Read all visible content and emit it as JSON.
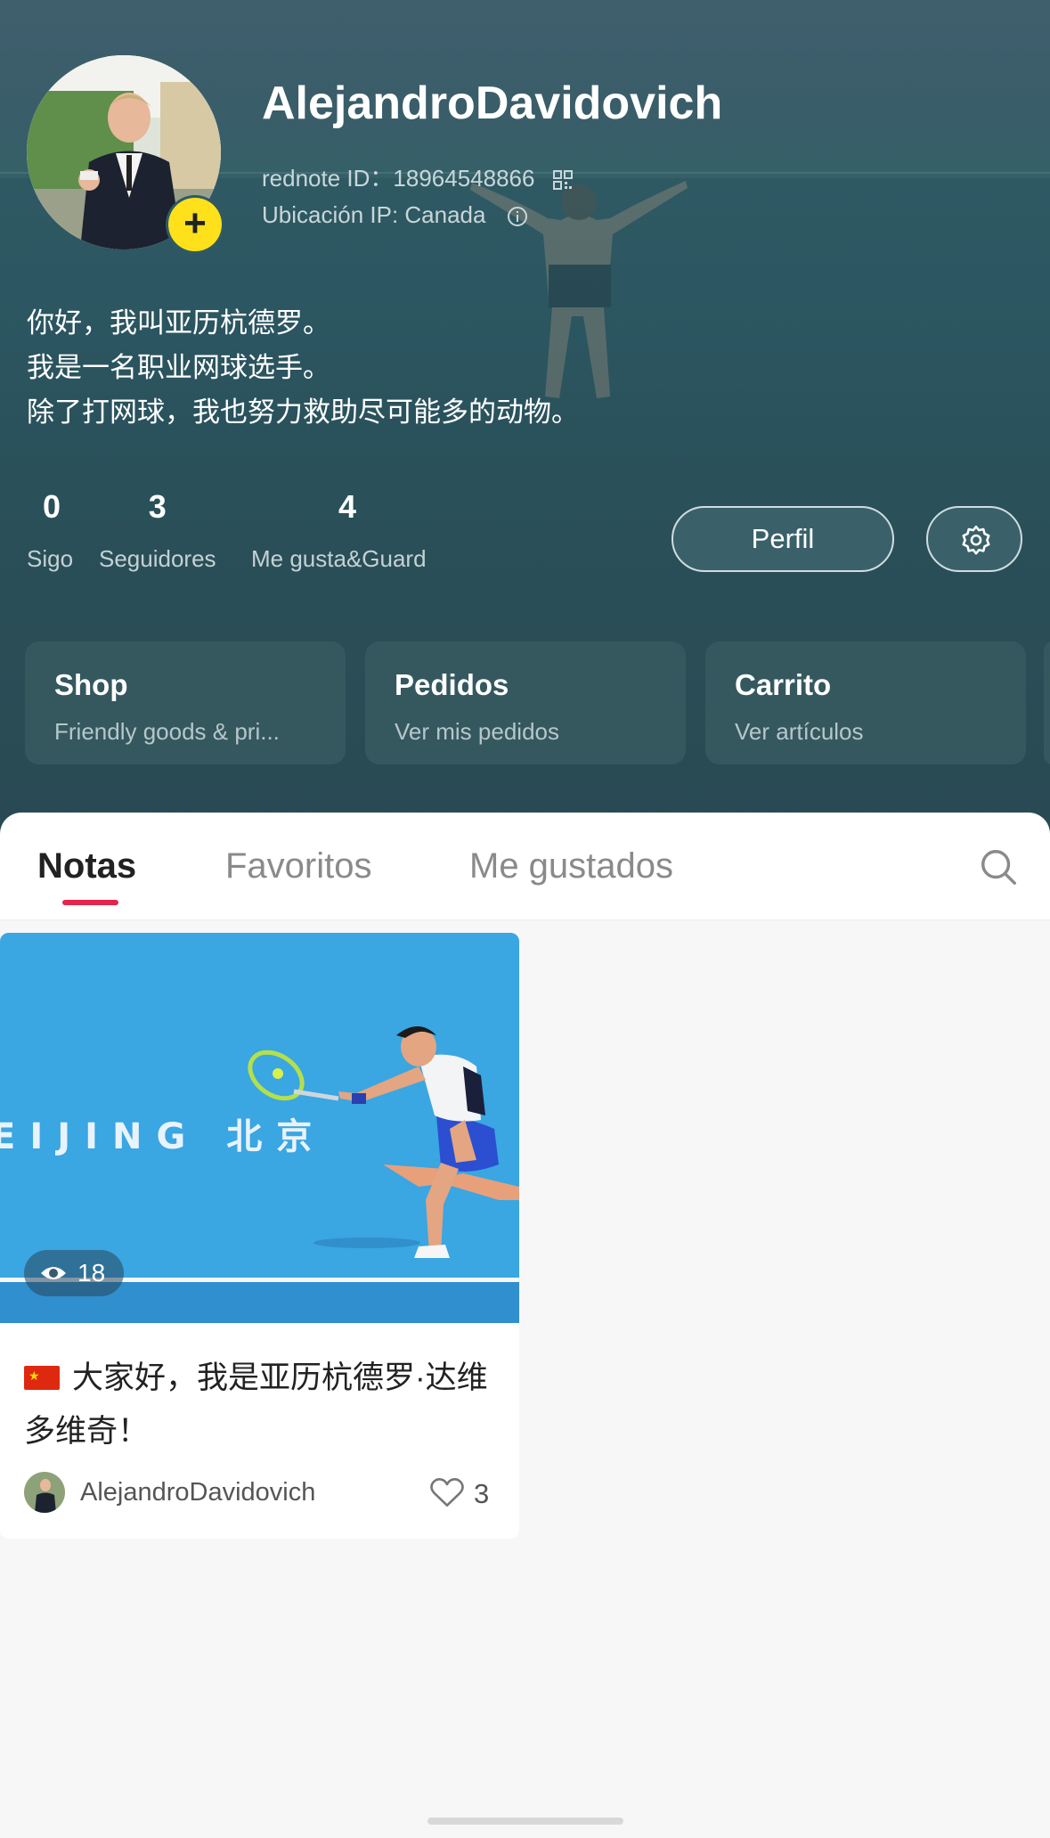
{
  "profile": {
    "username": "AlejandroDavidovich",
    "id_line": "rednote ID：18964548866",
    "ip_line": "Ubicación IP: Canada",
    "bio": [
      "你好，我叫亚历杭德罗。",
      "我是一名职业网球选手。",
      "除了打网球，我也努力救助尽可能多的动物。"
    ],
    "add_badge": "+"
  },
  "stats": [
    {
      "value": "0",
      "label": "Sigo"
    },
    {
      "value": "3",
      "label": "Seguidores"
    },
    {
      "value": "4",
      "label": "Me gusta&Guard"
    }
  ],
  "actions": {
    "perfil_label": "Perfil",
    "settings_icon": "gear-icon"
  },
  "cards": [
    {
      "title": "Shop",
      "subtitle": "Friendly goods & pri..."
    },
    {
      "title": "Pedidos",
      "subtitle": "Ver mis pedidos"
    },
    {
      "title": "Carrito",
      "subtitle": "Ver artículos"
    }
  ],
  "tabs": [
    {
      "label": "Notas",
      "active": true
    },
    {
      "label": "Favoritos",
      "active": false
    },
    {
      "label": "Me gustados",
      "active": false
    }
  ],
  "notes": [
    {
      "views": "18",
      "court_text": "EIJING 北京",
      "title": "大家好，我是亚历杭德罗·达维多维奇！",
      "author": "AlejandroDavidovich",
      "likes": "3"
    }
  ],
  "colors": {
    "accent": "#e5254a",
    "badge": "#ffe11b",
    "header_bg": "#2b5560"
  }
}
